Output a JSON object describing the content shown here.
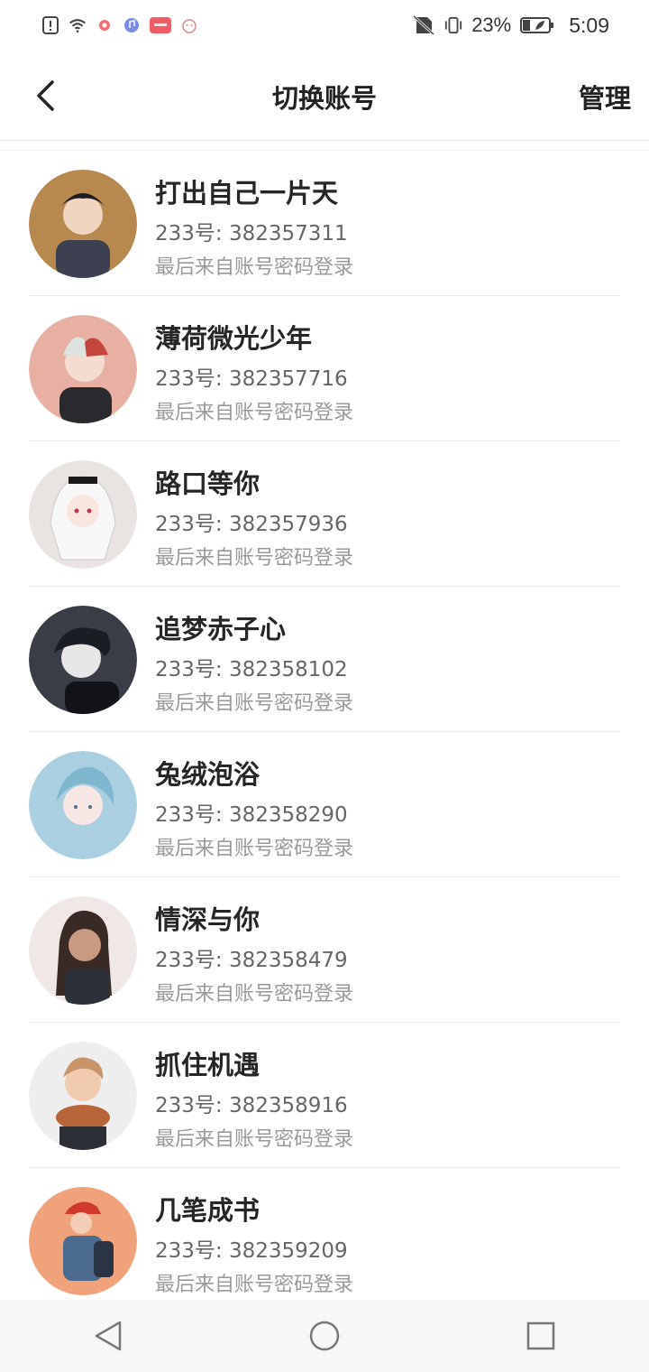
{
  "status_bar": {
    "battery_text": "23%",
    "time": "5:09",
    "icons": [
      "alert-icon",
      "wifi-icon",
      "app-notification-icon",
      "music-app-icon",
      "store-app-icon",
      "pet-app-icon",
      "no-sim-icon",
      "vibrate-icon",
      "battery-icon"
    ]
  },
  "header": {
    "title": "切换账号",
    "manage_label": "管理",
    "back_icon": "chevron-left-icon"
  },
  "accounts": [
    {
      "name": "打出自己一片天",
      "id_text": "233号: 382357311",
      "meta": "最后来自账号密码登录",
      "avatar_color": "#b8894f"
    },
    {
      "name": "薄荷微光少年",
      "id_text": "233号: 382357716",
      "meta": "最后来自账号密码登录",
      "avatar_color": "#e7b0a2"
    },
    {
      "name": "路口等你",
      "id_text": "233号: 382357936",
      "meta": "最后来自账号密码登录",
      "avatar_color": "#e9e4e2"
    },
    {
      "name": "追梦赤子心",
      "id_text": "233号: 382358102",
      "meta": "最后来自账号密码登录",
      "avatar_color": "#3a3d45"
    },
    {
      "name": "兔绒泡浴",
      "id_text": "233号: 382358290",
      "meta": "最后来自账号密码登录",
      "avatar_color": "#a9cfe0"
    },
    {
      "name": "情深与你",
      "id_text": "233号: 382358479",
      "meta": "最后来自账号密码登录",
      "avatar_color": "#efe8e6"
    },
    {
      "name": "抓住机遇",
      "id_text": "233号: 382358916",
      "meta": "最后来自账号密码登录",
      "avatar_color": "#c8946a"
    },
    {
      "name": "几笔成书",
      "id_text": "233号: 382359209",
      "meta": "最后来自账号密码登录",
      "avatar_color": "#f0a27b"
    }
  ],
  "nav_bar": {
    "buttons": [
      "back-triangle-icon",
      "home-circle-icon",
      "recents-square-icon"
    ]
  }
}
